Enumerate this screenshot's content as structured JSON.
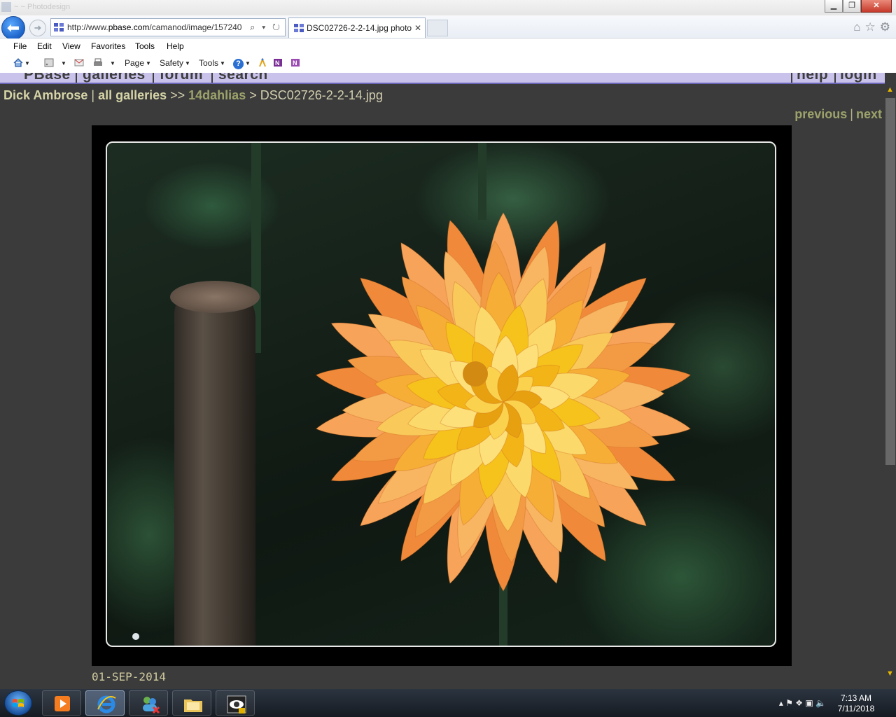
{
  "browser": {
    "window_title_ghost": "~ ~  Photodesign",
    "address": {
      "url_prefix": "http://www.",
      "url_domain": "pbase.com",
      "url_rest": "/camanod/image/157240",
      "tools": "⌕ ▾ ↻"
    },
    "tab": {
      "label": "DSC02726-2-2-14.jpg photo...",
      "close": "✕"
    },
    "menu": [
      "File",
      "Edit",
      "View",
      "Favorites",
      "Tools",
      "Help"
    ],
    "commands": {
      "page": "Page",
      "safety": "Safety",
      "tools": "Tools",
      "help_icon": "?"
    },
    "window_buttons": {
      "minimize": "▁",
      "restore": "❐",
      "close": "✕"
    },
    "right_icons": {
      "home": "⌂",
      "favorites": "☆",
      "settings": "⚙"
    }
  },
  "site": {
    "nav_tabs": [
      "PBase",
      "galleries",
      "forum",
      "search",
      "help",
      "login"
    ],
    "breadcrumb": {
      "owner": "Dick Ambrose",
      "sep1": " | ",
      "all_galleries": "all galleries",
      "sep2": " >> ",
      "gallery": "14dahlias",
      "sep3": " > ",
      "image": "DSC02726-2-2-14.jpg"
    },
    "pager": {
      "previous": "previous",
      "pipe": "|",
      "next": "next"
    },
    "caption": "01-SEP-2014"
  },
  "taskbar": {
    "tray_icons": "▴  ⚑  ❖  ▣  🔈",
    "clock": {
      "time": "7:13 AM",
      "date": "7/11/2018"
    }
  },
  "colors": {
    "page_bg": "#3b3b3b",
    "link_olive": "#9da26b",
    "petal_orange": "#f08a3a",
    "petal_yellow": "#f6c21c"
  }
}
